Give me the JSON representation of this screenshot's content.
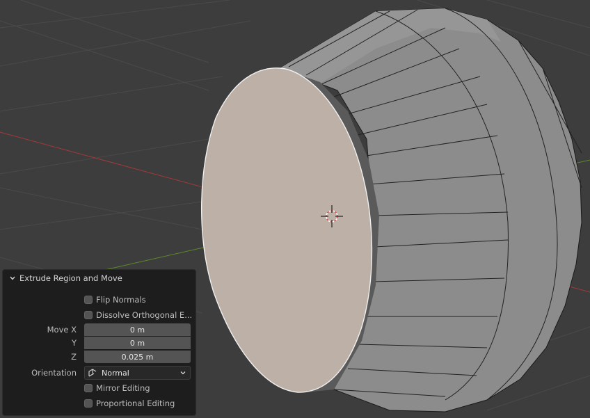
{
  "operator_panel": {
    "title": "Extrude Region and Move",
    "flip_normals": {
      "label": "Flip Normals",
      "checked": false
    },
    "dissolve_orthogonal": {
      "label": "Dissolve Orthogonal E...",
      "checked": false
    },
    "move": {
      "x_label": "Move X",
      "x_value": "0 m",
      "y_label": "Y",
      "y_value": "0 m",
      "z_label": "Z",
      "z_value": "0.025 m"
    },
    "orientation": {
      "label": "Orientation",
      "value": "Normal"
    },
    "mirror_editing": {
      "label": "Mirror Editing",
      "checked": false
    },
    "proportional_editing": {
      "label": "Proportional Editing",
      "checked": false
    }
  },
  "viewport": {
    "background_color": "#3d3d3d",
    "x_axis_color": "#a33a3a",
    "y_axis_color": "#5e8a2a",
    "selected_face_color": "#bdb0a6",
    "mesh_color": "#8c8c8c",
    "cursor_icon": "3d-cursor-icon"
  }
}
